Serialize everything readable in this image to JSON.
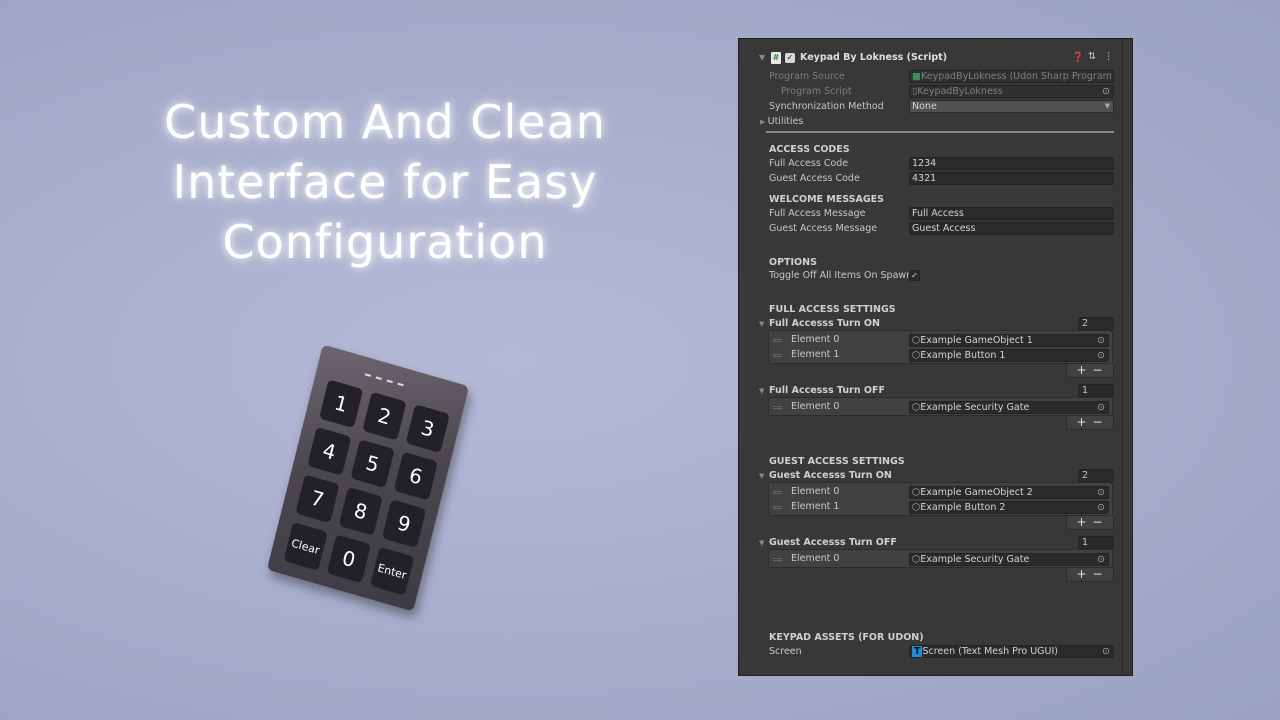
{
  "headline": {
    "line1": "Custom And Clean",
    "line2": "Interface for Easy",
    "line3": "Configuration"
  },
  "keypad": {
    "keys": [
      "1",
      "2",
      "3",
      "4",
      "5",
      "6",
      "7",
      "8",
      "9",
      "Clear",
      "0",
      "Enter"
    ]
  },
  "inspector": {
    "component_title": "Keypad By Lokness (Script)",
    "program_source_label": "Program Source",
    "program_source_value": "KeypadByLokness (Udon Sharp Program A",
    "program_script_label": "Program Script",
    "program_script_value": "KeypadByLokness",
    "sync_label": "Synchronization Method",
    "sync_value": "None",
    "utilities_label": "Utilities",
    "access_codes": {
      "header": "ACCESS CODES",
      "full_label": "Full Access Code",
      "full_value": "1234",
      "guest_label": "Guest Access Code",
      "guest_value": "4321"
    },
    "welcome": {
      "header": "WELCOME MESSAGES",
      "full_label": "Full Access Message",
      "full_value": "Full Access",
      "guest_label": "Guest Access Message",
      "guest_value": "Guest Access"
    },
    "options": {
      "header": "OPTIONS",
      "toggle_label": "Toggle Off All Items On Spawn",
      "toggle_checked": true
    },
    "full_settings": {
      "header": "FULL ACCESS SETTINGS",
      "on": {
        "label": "Full Accesss Turn ON",
        "count": "2",
        "elements": [
          {
            "name": "Element 0",
            "value": "Example GameObject 1"
          },
          {
            "name": "Element 1",
            "value": "Example Button 1"
          }
        ]
      },
      "off": {
        "label": "Full Accesss Turn OFF",
        "count": "1",
        "elements": [
          {
            "name": "Element 0",
            "value": "Example Security Gate"
          }
        ]
      }
    },
    "guest_settings": {
      "header": "GUEST ACCESS SETTINGS",
      "on": {
        "label": "Guest Accesss Turn ON",
        "count": "2",
        "elements": [
          {
            "name": "Element 0",
            "value": "Example GameObject 2"
          },
          {
            "name": "Element 1",
            "value": "Example Button 2"
          }
        ]
      },
      "off": {
        "label": "Guest Accesss Turn OFF",
        "count": "1",
        "elements": [
          {
            "name": "Element 0",
            "value": "Example Security Gate"
          }
        ]
      }
    },
    "assets": {
      "header": "KEYPAD ASSETS (FOR UDON)",
      "screen_label": "Screen",
      "screen_value": "Screen (Text Mesh Pro UGUI)"
    },
    "plus_minus": "+−"
  }
}
